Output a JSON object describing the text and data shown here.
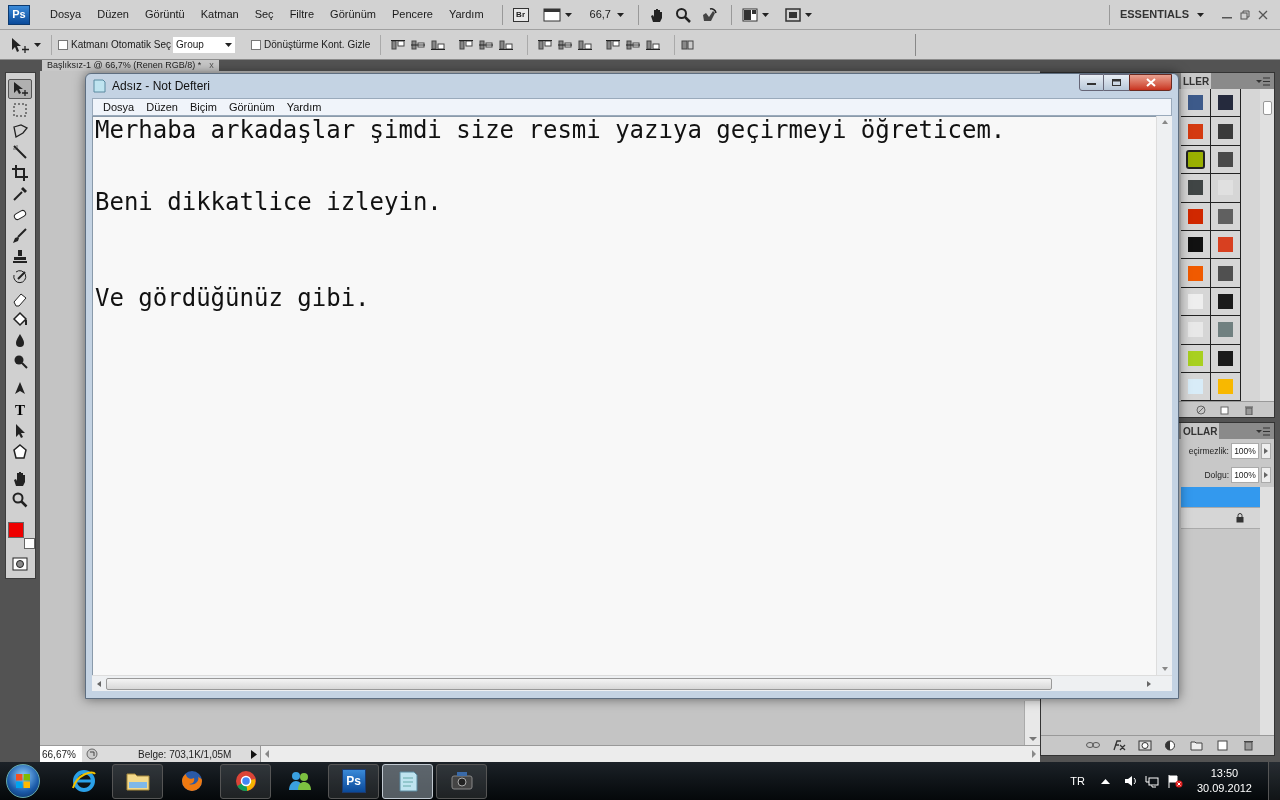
{
  "photoshop": {
    "logo": "Ps",
    "menu": [
      "Dosya",
      "Düzen",
      "Görüntü",
      "Katman",
      "Seç",
      "Filtre",
      "Görünüm",
      "Pencere",
      "Yardım"
    ],
    "bridge_button": "Br",
    "zoom_value": "66,7",
    "workspace": "ESSENTIALS",
    "options_bar": {
      "auto_select": {
        "label": "Katmanı Otomatik Seç",
        "checked": false
      },
      "auto_select_mode": "Group",
      "transform_controls": {
        "label": "Dönüştürme Kont. Gizle",
        "checked": false
      }
    },
    "document_tab": "Başlıksız-1 @ 66,7% (Renen RGB/8) *",
    "document_tab_close": "x",
    "tools": [
      {
        "kind": "move",
        "selected": true
      },
      {
        "kind": "marquee",
        "selected": false
      },
      {
        "kind": "lasso",
        "selected": false
      },
      {
        "kind": "wand",
        "selected": false
      },
      {
        "kind": "crop",
        "selected": false
      },
      {
        "kind": "eyedropper",
        "selected": false
      },
      {
        "kind": "healing",
        "selected": false
      },
      {
        "kind": "brush",
        "selected": false
      },
      {
        "kind": "stamp",
        "selected": false
      },
      {
        "kind": "history",
        "selected": false
      },
      {
        "kind": "eraser",
        "selected": false
      },
      {
        "kind": "bucket",
        "selected": false
      },
      {
        "kind": "blur",
        "selected": false
      },
      {
        "kind": "dodge",
        "selected": false
      },
      {
        "kind": "pen",
        "selected": false
      },
      {
        "kind": "type",
        "glyph": "T",
        "selected": false
      },
      {
        "kind": "path",
        "selected": false
      },
      {
        "kind": "shape",
        "selected": false
      },
      {
        "kind": "hand",
        "selected": false
      },
      {
        "kind": "zoom",
        "selected": false
      }
    ],
    "color_chips": [
      {
        "kind": "foreground",
        "color": "#ee0000"
      },
      {
        "kind": "background",
        "color": "#ffffff"
      }
    ],
    "status": {
      "zoom": "66,67%",
      "document": "Belge: 703,1K/1,05M"
    },
    "swatches_panel": {
      "tab": "LLER",
      "swatches": [
        {
          "color": "#3d5a8a",
          "selected": false
        },
        {
          "color": "#252a3d",
          "selected": false
        },
        {
          "color": "#d43a10",
          "selected": false
        },
        {
          "color": "#3a3a3a",
          "selected": false
        },
        {
          "color": "#9ab000",
          "selected": true
        },
        {
          "color": "#4a4a4a",
          "selected": false
        },
        {
          "color": "#404545",
          "selected": false
        },
        {
          "color": "#e0e0e0",
          "selected": false
        },
        {
          "color": "#d02800",
          "selected": false
        },
        {
          "color": "#606060",
          "selected": false
        },
        {
          "color": "#111111",
          "selected": false
        },
        {
          "color": "#d84020",
          "selected": false
        },
        {
          "color": "#f05a00",
          "selected": false
        },
        {
          "color": "#505050",
          "selected": false
        },
        {
          "color": "#eeeeee",
          "selected": false
        },
        {
          "color": "#1a1a1a",
          "selected": false
        },
        {
          "color": "#e8e8e8",
          "selected": false
        },
        {
          "color": "#708080",
          "selected": false
        },
        {
          "color": "#a8d020",
          "selected": false
        },
        {
          "color": "#1a1a1a",
          "selected": false
        },
        {
          "color": "#d8ecf8",
          "selected": false
        },
        {
          "color": "#f8b800",
          "selected": false
        }
      ]
    },
    "layers_panel": {
      "tab": "OLLAR",
      "opacity_label": "eçirmezlik:",
      "opacity": "100%",
      "fill_label": "Dolgu:",
      "fill": "100%",
      "layers": [
        {
          "selected": true,
          "locked": false
        },
        {
          "selected": false,
          "locked": true
        }
      ]
    }
  },
  "notepad": {
    "title": "Adsız - Not Defteri",
    "menu": [
      "Dosya",
      "Düzen",
      "Biçim",
      "Görünüm",
      "Yardım"
    ],
    "text": "Merhaba arkadaşlar şimdi size resmi yazıya geçirmeyi öğreticem.\n\n\nBeni dikkatlice izleyin.\n\n\n\nVe gördüğünüz gibi."
  },
  "taskbar": {
    "apps": [
      {
        "kind": "explorer-ie",
        "running": false,
        "selected": false
      },
      {
        "kind": "folder",
        "running": true,
        "selected": false
      },
      {
        "kind": "firefox",
        "running": false,
        "selected": false
      },
      {
        "kind": "chrome",
        "running": true,
        "selected": false
      },
      {
        "kind": "messenger",
        "running": false,
        "selected": false
      },
      {
        "kind": "photoshop",
        "label": "Ps",
        "running": true,
        "selected": false
      },
      {
        "kind": "notepad",
        "running": true,
        "selected": true
      },
      {
        "kind": "camera",
        "running": true,
        "selected": false
      }
    ],
    "language": "TR",
    "time": "13:50",
    "date": "30.09.2012"
  }
}
